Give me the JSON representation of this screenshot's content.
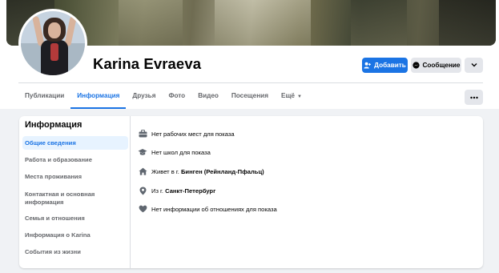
{
  "profile": {
    "name": "Karina Evraeva"
  },
  "actions": {
    "add_label": "Добавить",
    "message_label": "Сообщение"
  },
  "tabs": [
    {
      "label": "Публикации"
    },
    {
      "label": "Информация"
    },
    {
      "label": "Друзья"
    },
    {
      "label": "Фото"
    },
    {
      "label": "Видео"
    },
    {
      "label": "Посещения"
    },
    {
      "label": "Ещё"
    }
  ],
  "about": {
    "title": "Информация",
    "nav": [
      {
        "label": "Общие сведения"
      },
      {
        "label": "Работа и образование"
      },
      {
        "label": "Места проживания"
      },
      {
        "label": "Контактная и основная информация"
      },
      {
        "label": "Семья и отношения"
      },
      {
        "label": "Информация о Karina"
      },
      {
        "label": "События из жизни"
      }
    ],
    "rows": [
      {
        "icon": "briefcase-icon",
        "text": "Нет рабочих мест для показа"
      },
      {
        "icon": "graduation-cap-icon",
        "text": "Нет школ для показа"
      },
      {
        "icon": "home-icon",
        "prefix": "Живет в г. ",
        "strong": "Бинген (Рейнланд-Пфальц)"
      },
      {
        "icon": "location-pin-icon",
        "prefix": "Из г. ",
        "strong": "Санкт-Петербург"
      },
      {
        "icon": "heart-icon",
        "text": "Нет информации об отношениях для показа"
      }
    ]
  },
  "colors": {
    "accent": "#1b74e4",
    "secondary_button": "#e4e6eb",
    "muted_text": "#65676b",
    "page_bg": "#f0f2f5"
  }
}
